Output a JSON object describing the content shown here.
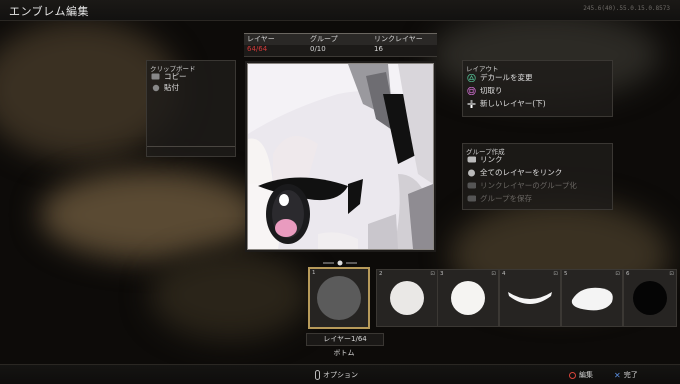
{
  "window": {
    "title": "エンブレム編集",
    "version": "245.6(40).55.0.15.0.8573"
  },
  "stats": {
    "headers": [
      "レイヤー",
      "グループ",
      "リンクレイヤー"
    ],
    "values": [
      "64/64",
      "0/10",
      "16"
    ]
  },
  "clipboard": {
    "title": "クリップボード",
    "items": [
      "コピー",
      "貼付"
    ]
  },
  "layout": {
    "title": "レイアウト",
    "items": [
      "デカールを変更",
      "切取り",
      "新しいレイヤー(下)"
    ]
  },
  "group": {
    "title": "グループ作成",
    "items": [
      "リンク",
      "全てのレイヤーをリンク",
      "リンクレイヤーのグループ化",
      "グループを保存"
    ]
  },
  "layers": {
    "thumbs": [
      {
        "num": "1",
        "shape": "circle-dark",
        "selected": true
      },
      {
        "num": "2",
        "shape": "circle-white",
        "selected": false
      },
      {
        "num": "3",
        "shape": "circle-white",
        "selected": false
      },
      {
        "num": "4",
        "shape": "arc-white",
        "selected": false
      },
      {
        "num": "5",
        "shape": "blob-white",
        "selected": false
      },
      {
        "num": "6",
        "shape": "circle-black",
        "selected": false
      }
    ],
    "current_label": "レイヤー1/64",
    "bottom_label": "ボトム"
  },
  "footer": {
    "option": "オプション",
    "edit": "編集",
    "done": "完了"
  },
  "colors": {
    "accent_gold": "#b79a5a",
    "counter_red": "#d23a3a",
    "circle_btn": "#d9453b",
    "cross_btn": "#5a8ee0"
  }
}
